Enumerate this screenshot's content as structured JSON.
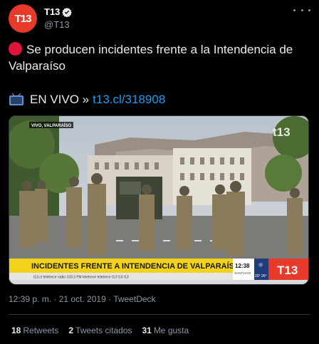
{
  "account": {
    "avatar_text": "T13",
    "name": "T13",
    "handle": "@T13",
    "brand_color": "#e83a2b"
  },
  "tweet": {
    "line1": "Se producen incidentes frente a la Intendencia de Valparaíso",
    "live_text": "EN VIVO »",
    "link_text": "t13.cl/318908",
    "timestamp": "12:39 p. m. · 21 oct. 2019 · TweetDeck"
  },
  "video": {
    "live_badge": "VIVO, VALPARAÍSO",
    "watermark": "t13",
    "lower_third": "INCIDENTES FRENTE A INTENDENCIA DE VALPARAÍSO",
    "ticker": "t13.cl   teletrece radio 103.3 FM   teletrece   teletrece   t13   t13   t13",
    "clock": "12:38",
    "city": "SANTIAGO",
    "temps": "20° 26°",
    "logo": "T13"
  },
  "stats": {
    "retweets_count": "18",
    "retweets_label": "Retweets",
    "quotes_count": "2",
    "quotes_label": "Tweets citados",
    "likes_count": "31",
    "likes_label": "Me gusta"
  },
  "icons": {
    "verified": "verified-badge-icon",
    "more": "more-options-icon",
    "live_dot": "red-circle-icon",
    "tv": "television-icon"
  }
}
